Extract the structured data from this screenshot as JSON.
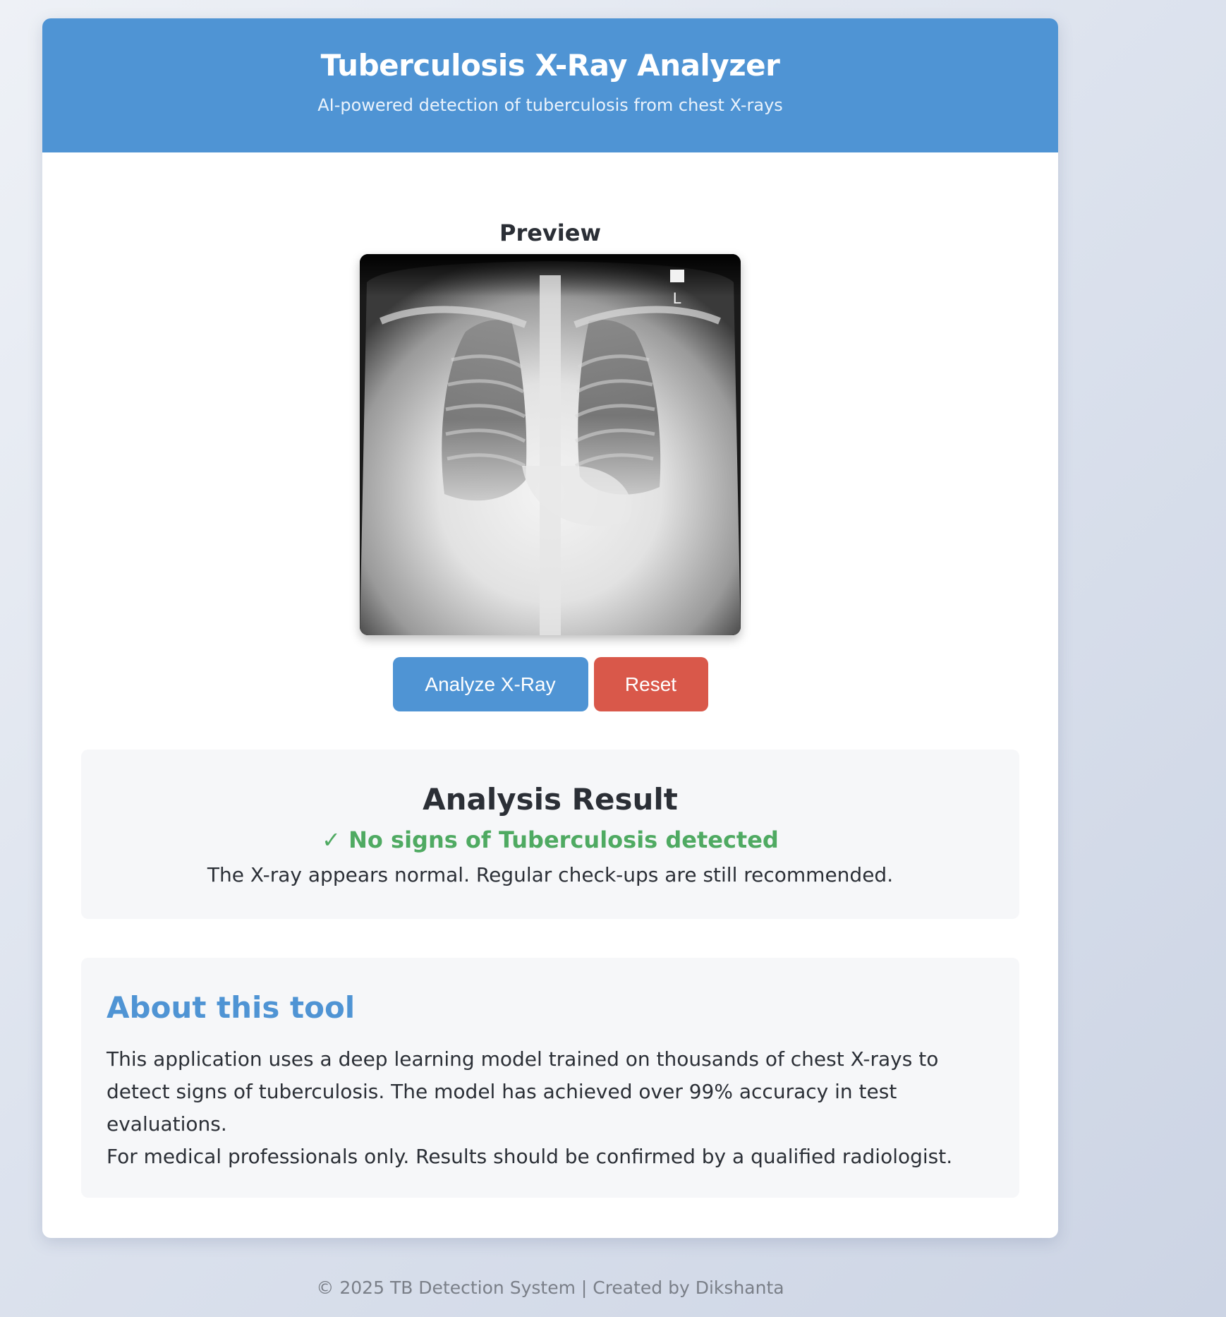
{
  "header": {
    "title": "Tuberculosis X-Ray Analyzer",
    "subtitle": "AI-powered detection of tuberculosis from chest X-rays"
  },
  "preview": {
    "label": "Preview",
    "image": "chest-xray-image",
    "marker_text": "L"
  },
  "actions": {
    "analyze_label": "Analyze X-Ray",
    "reset_label": "Reset"
  },
  "result": {
    "title": "Analysis Result",
    "status_icon": "✓",
    "status": "No signs of Tuberculosis detected",
    "description": "The X-ray appears normal. Regular check-ups are still recommended."
  },
  "about": {
    "title": "About this tool",
    "paragraph": "This application uses a deep learning model trained on thousands of chest X-rays to detect signs of tuberculosis. The model has achieved over 99% accuracy in test evaluations.",
    "disclaimer": "For medical professionals only. Results should be confirmed by a qualified radiologist."
  },
  "footer": {
    "text": "© 2025 TB Detection System | Created by Dikshanta"
  },
  "colors": {
    "primary": "#4f94d4",
    "danger": "#d9584a",
    "success": "#4faa62"
  }
}
